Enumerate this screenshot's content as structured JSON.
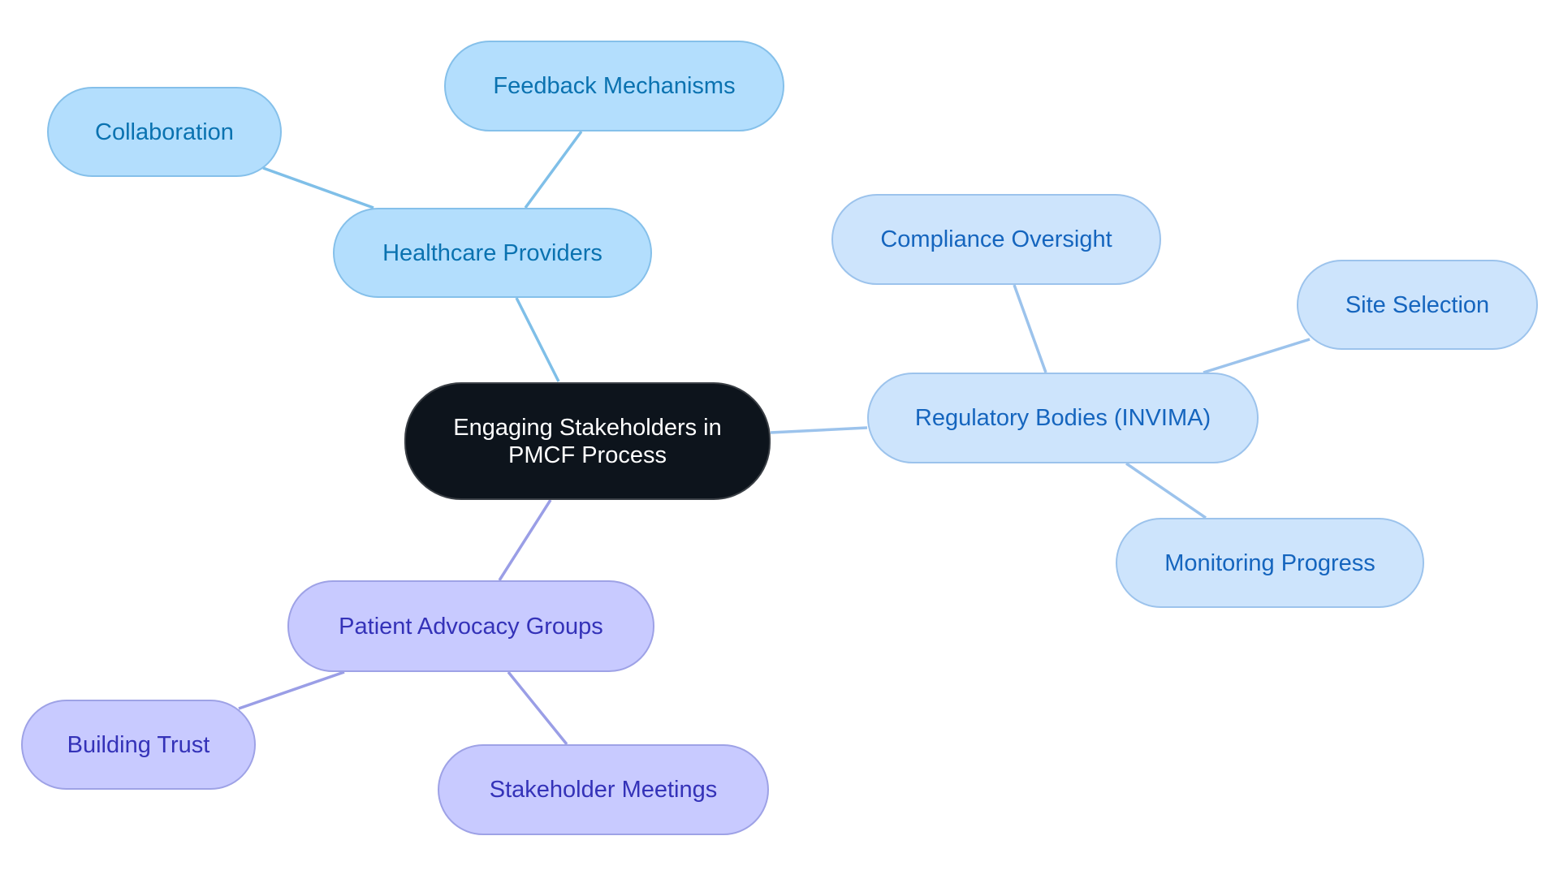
{
  "diagram": {
    "type": "mind-map",
    "root": {
      "id": "root",
      "label": "Engaging Stakeholders in PMCF Process"
    },
    "branches": [
      {
        "id": "hp",
        "label": "Healthcare Providers",
        "theme": "sky",
        "children": [
          {
            "id": "fm",
            "label": "Feedback Mechanisms"
          },
          {
            "id": "co",
            "label": "Collaboration"
          }
        ]
      },
      {
        "id": "rb",
        "label": "Regulatory Bodies (INVIMA)",
        "theme": "blue",
        "children": [
          {
            "id": "cov",
            "label": "Compliance Oversight"
          },
          {
            "id": "ss",
            "label": "Site Selection"
          },
          {
            "id": "mp",
            "label": "Monitoring Progress"
          }
        ]
      },
      {
        "id": "pag",
        "label": "Patient Advocacy Groups",
        "theme": "violet",
        "children": [
          {
            "id": "bt",
            "label": "Building Trust"
          },
          {
            "id": "sm",
            "label": "Stakeholder Meetings"
          }
        ]
      }
    ],
    "colors": {
      "root_fill": "#0d141c",
      "root_text": "#ffffff",
      "sky_fill": "#b3defd",
      "sky_text": "#0a72b0",
      "sky_edge": "#7fbfe8",
      "blue_fill": "#cde4fc",
      "blue_text": "#1565be",
      "blue_edge": "#9cc3ec",
      "violet_fill": "#c8caff",
      "violet_text": "#3432b8",
      "violet_edge": "#9a9ee6"
    }
  }
}
